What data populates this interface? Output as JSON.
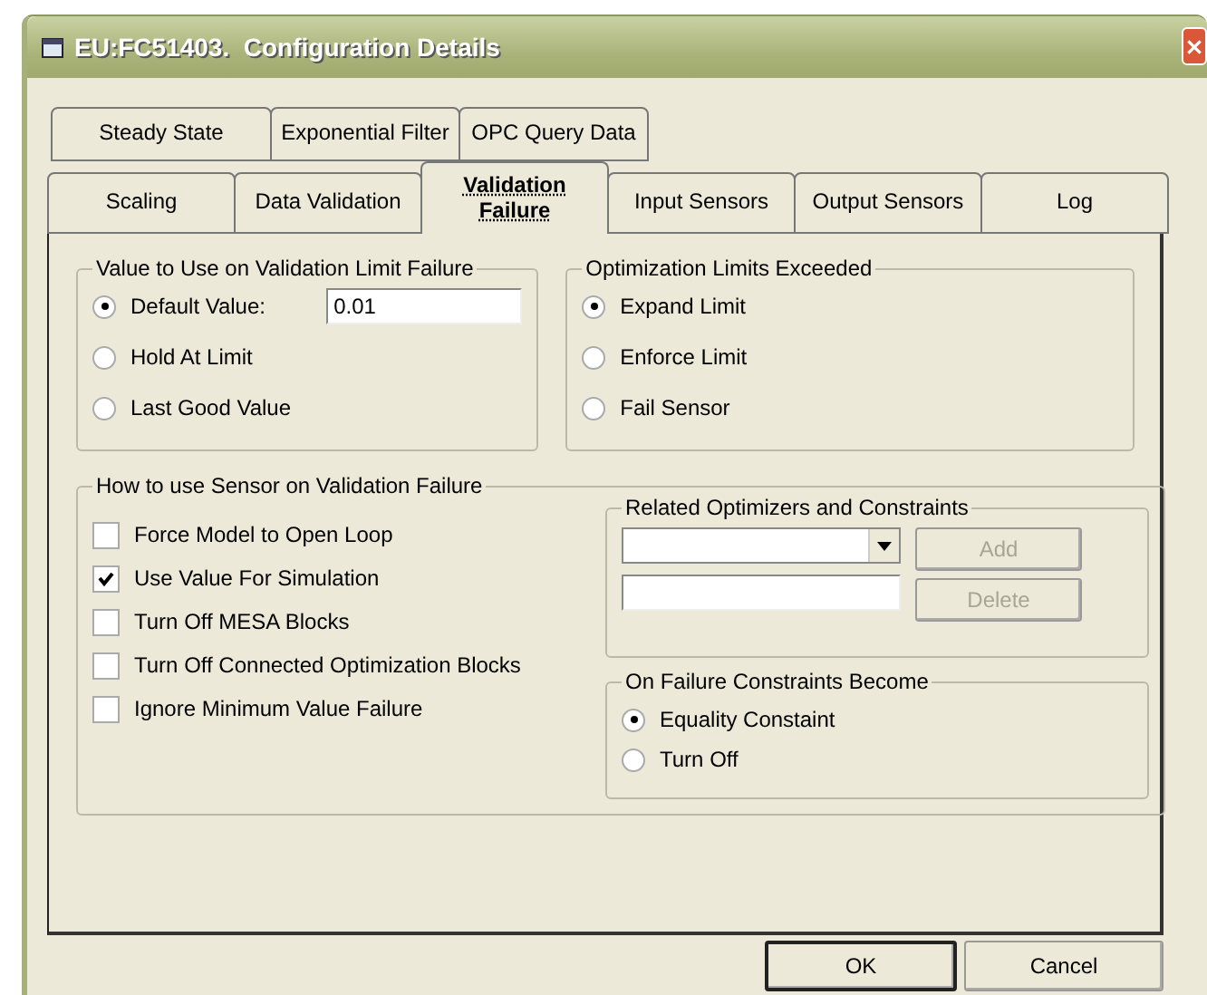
{
  "window": {
    "title": "EU:FC51403.  Configuration Details"
  },
  "tabs_back_row": [
    {
      "label": "Steady State",
      "selected": false
    },
    {
      "label": "Exponential Filter",
      "selected": false
    },
    {
      "label": "OPC Query Data",
      "selected": false
    }
  ],
  "tabs_front_row": [
    {
      "label": "Scaling",
      "selected": false
    },
    {
      "label": "Data Validation",
      "selected": false
    },
    {
      "label": "Validation Failure",
      "selected": true
    },
    {
      "label": "Input Sensors",
      "selected": false
    },
    {
      "label": "Output Sensors",
      "selected": false
    },
    {
      "label": "Log",
      "selected": false
    }
  ],
  "value_on_limit_failure": {
    "title": "Value to Use on Validation Limit Failure",
    "options": [
      {
        "label": "Default Value:",
        "selected": true
      },
      {
        "label": "Hold At Limit",
        "selected": false
      },
      {
        "label": "Last Good Value",
        "selected": false
      }
    ],
    "default_value": "0.01"
  },
  "optimization_limits_exceeded": {
    "title": "Optimization Limits Exceeded",
    "options": [
      {
        "label": "Expand Limit",
        "selected": true
      },
      {
        "label": "Enforce Limit",
        "selected": false
      },
      {
        "label": "Fail Sensor",
        "selected": false
      }
    ]
  },
  "sensor_on_failure": {
    "title": "How to use Sensor on Validation Failure",
    "options": [
      {
        "label": "Force Model to Open Loop",
        "checked": false
      },
      {
        "label": "Use Value For Simulation",
        "checked": true
      },
      {
        "label": "Turn Off MESA Blocks",
        "checked": false
      },
      {
        "label": "Turn Off Connected Optimization Blocks",
        "checked": false
      },
      {
        "label": "Ignore Minimum Value Failure",
        "checked": false
      }
    ]
  },
  "related_optimizers": {
    "title": "Related Optimizers and Constraints",
    "buttons": [
      {
        "label": "Add",
        "disabled": true
      },
      {
        "label": "Delete",
        "disabled": true
      }
    ]
  },
  "constraints_become": {
    "title": "On Failure Constraints Become",
    "options": [
      {
        "label": "Equality Constaint",
        "selected": true
      },
      {
        "label": "Turn Off",
        "selected": false
      }
    ]
  },
  "buttons": [
    {
      "label": "OK",
      "default": true
    },
    {
      "label": "Cancel",
      "default": false
    }
  ]
}
